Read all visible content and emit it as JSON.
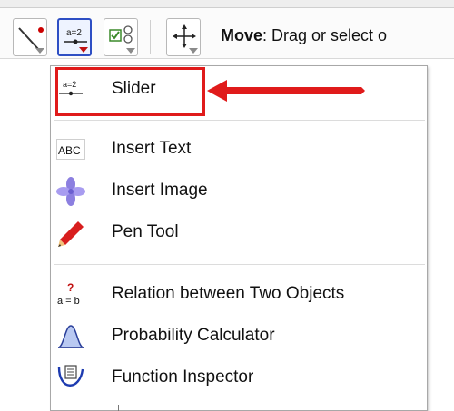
{
  "toolbar": {
    "status_bold": "Move",
    "status_rest": ": Drag or select o"
  },
  "menu": {
    "items": [
      {
        "label": "Slider",
        "icon": "slider-icon",
        "icon_text": "a=2"
      },
      {
        "label": "Insert Text",
        "icon": "insert-text-icon",
        "icon_text": "ABC"
      },
      {
        "label": "Insert Image",
        "icon": "insert-image-icon"
      },
      {
        "label": "Pen Tool",
        "icon": "pen-icon"
      },
      {
        "label": "Relation between Two Objects",
        "icon": "relation-icon",
        "icon_text_top": "?",
        "icon_text": "a = b"
      },
      {
        "label": "Probability Calculator",
        "icon": "probability-calculator-icon"
      },
      {
        "label": "Function Inspector",
        "icon": "function-inspector-icon"
      }
    ]
  },
  "colors": {
    "highlight": "#e01b1b",
    "active_tool_border": "#2e4fc4"
  }
}
